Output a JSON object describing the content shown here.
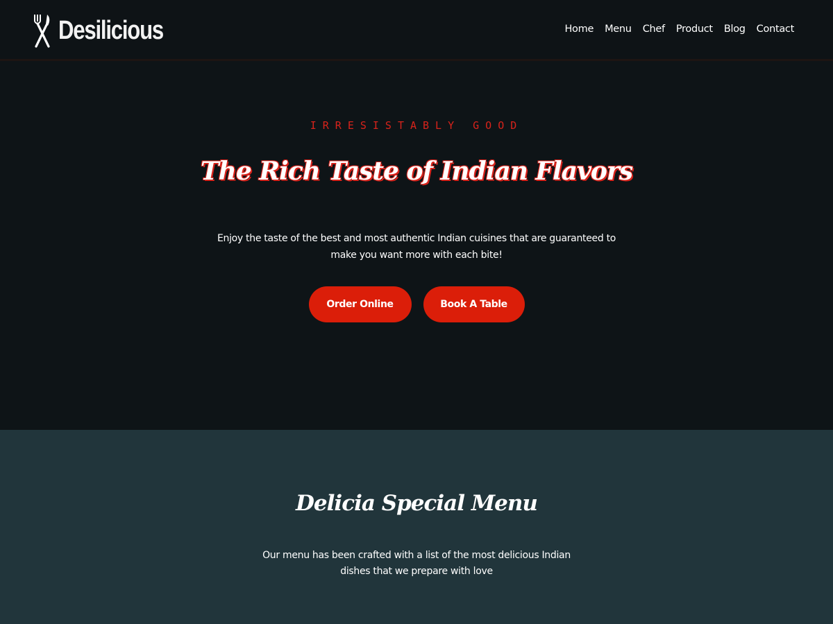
{
  "header": {
    "logo_text": "Desilicious",
    "logo_icon": "fork-knife-icon",
    "nav": [
      {
        "label": "Home"
      },
      {
        "label": "Menu"
      },
      {
        "label": "Chef"
      },
      {
        "label": "Product"
      },
      {
        "label": "Blog"
      },
      {
        "label": "Contact"
      }
    ]
  },
  "hero": {
    "eyebrow": "IRRESISTABLY GOOD",
    "title": "The Rich Taste of Indian Flavors",
    "description": "Enjoy the taste of the best and most authentic Indian cuisines that are guaranteed to make you want more with each bite!",
    "buttons": {
      "order": "Order Online",
      "book": "Book A Table"
    }
  },
  "menu_section": {
    "title": "Delicia Special Menu",
    "description": "Our menu has been crafted with a list of the most delicious Indian dishes that we prepare with love"
  },
  "colors": {
    "accent": "#db1e09",
    "hero_bg": "#0e1417",
    "menu_bg": "#21353b"
  }
}
